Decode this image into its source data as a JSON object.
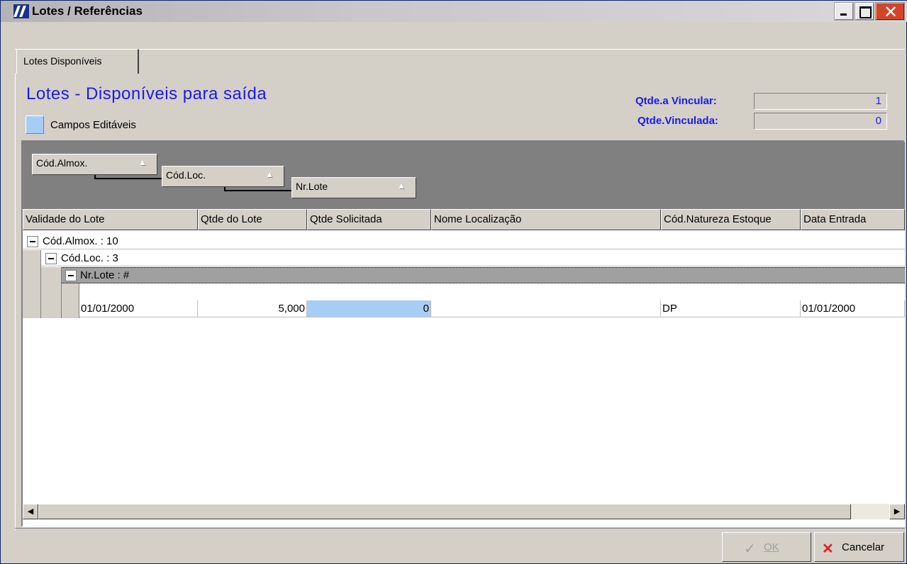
{
  "window": {
    "title": "Lotes / Referências"
  },
  "tabs": [
    {
      "label": "Lotes Disponíveis"
    }
  ],
  "heading": "Lotes - Disponíveis para saída",
  "legend": {
    "label": "Campos Editáveis",
    "color": "#a8cdf5"
  },
  "quantities": {
    "a_vincular_label": "Qtde.a Vincular:",
    "a_vincular_value": "1",
    "vinculada_label": "Qtde.Vinculada:",
    "vinculada_value": "0"
  },
  "group_by": [
    "Cód.Almox.",
    "Cód.Loc.",
    "Nr.Lote"
  ],
  "columns": [
    "Validade do Lote",
    "Qtde do Lote",
    "Qtde Solicitada",
    "Nome Localização",
    "Cód.Natureza Estoque",
    "Data Entrada"
  ],
  "groups": {
    "level1": "Cód.Almox. : 10",
    "level2": "Cód.Loc. : 3",
    "level3": "Nr.Lote : #"
  },
  "rows": [
    {
      "validade": "01/01/2000",
      "qtde_lote": "5,000",
      "qtde_solicitada": "0",
      "nome_localizacao": "",
      "natureza": "DP",
      "data_entrada": "01/01/2000"
    }
  ],
  "buttons": {
    "ok": "OK",
    "cancel": "Cancelar"
  },
  "colors": {
    "accent": "#1a1aee",
    "editable": "#a8cdf5",
    "close": "#d2452c"
  }
}
